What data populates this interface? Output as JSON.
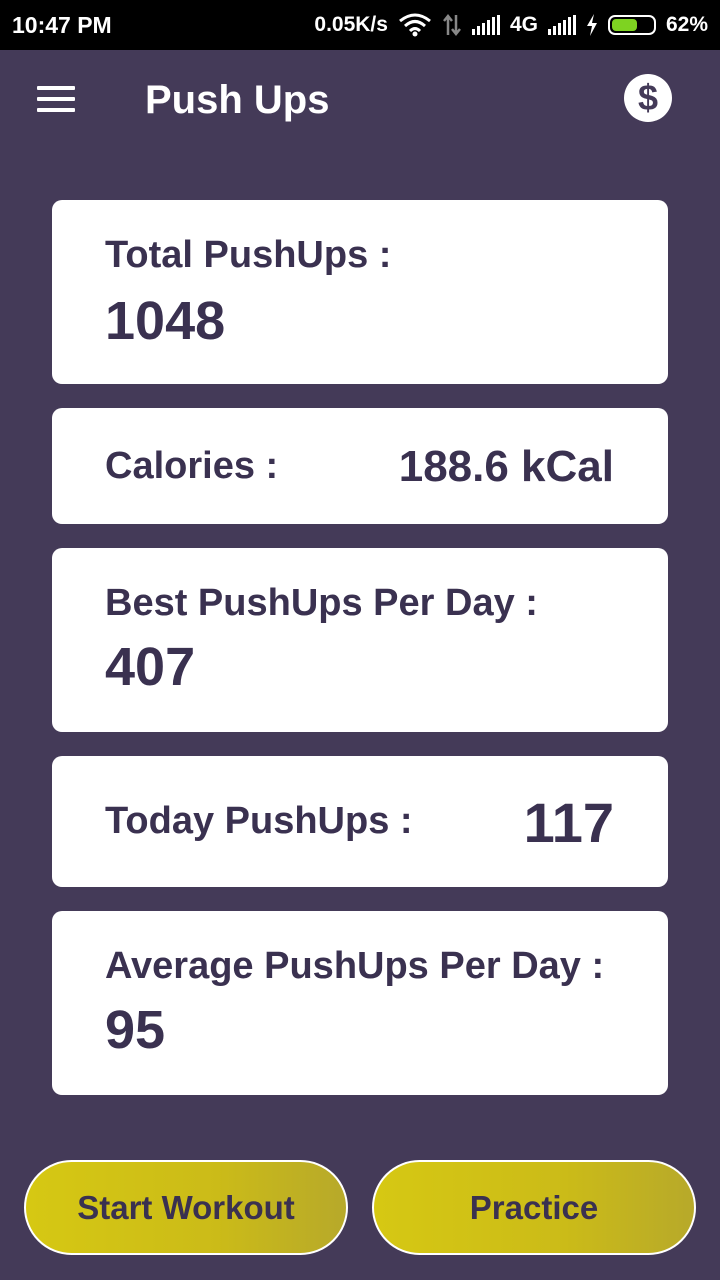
{
  "status_bar": {
    "time": "10:47 PM",
    "network_speed": "0.05K/s",
    "network_type": "4G",
    "battery_percent": "62%",
    "battery_level": 0.62
  },
  "app_bar": {
    "title": "Push Ups",
    "menu_icon": "hamburger-menu-icon",
    "dollar_icon": "dollar-icon",
    "dollar_glyph": "$"
  },
  "stats": {
    "total": {
      "label": "Total PushUps :",
      "value": "1048"
    },
    "calories": {
      "label": "Calories :",
      "value": "188.6 kCal"
    },
    "best": {
      "label": "Best PushUps Per Day :",
      "value": "407"
    },
    "today": {
      "label": "Today PushUps :",
      "value": "117"
    },
    "average": {
      "label": "Average PushUps Per Day :",
      "value": "95"
    }
  },
  "actions": {
    "start_workout": "Start Workout",
    "practice": "Practice"
  },
  "colors": {
    "background": "#443a58",
    "card_text": "#3a3150",
    "button": "#d6c813"
  }
}
